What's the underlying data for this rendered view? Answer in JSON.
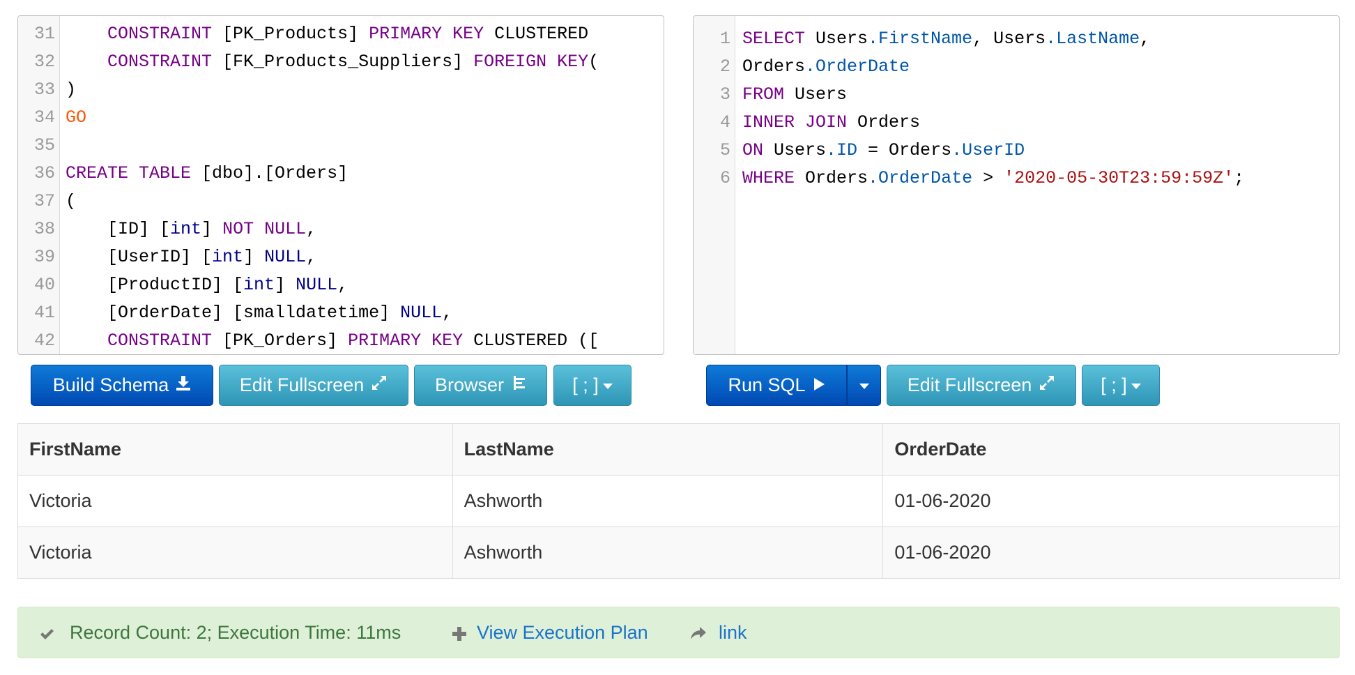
{
  "schema_editor": {
    "lines": [
      {
        "n": "31",
        "tokens": [
          {
            "t": "    "
          },
          {
            "t": "CONSTRAINT",
            "c": "kw"
          },
          {
            "t": " [PK_Products] "
          },
          {
            "t": "PRIMARY KEY",
            "c": "kw"
          },
          {
            "t": " CLUSTERED"
          }
        ]
      },
      {
        "n": "32",
        "tokens": [
          {
            "t": "    "
          },
          {
            "t": "CONSTRAINT",
            "c": "kw"
          },
          {
            "t": " [FK_Products_Suppliers] "
          },
          {
            "t": "FOREIGN KEY",
            "c": "kw"
          },
          {
            "t": "("
          }
        ]
      },
      {
        "n": "33",
        "tokens": [
          {
            "t": ")"
          }
        ]
      },
      {
        "n": "34",
        "tokens": [
          {
            "t": "GO",
            "c": "go"
          }
        ]
      },
      {
        "n": "35",
        "tokens": [
          {
            "t": ""
          }
        ]
      },
      {
        "n": "36",
        "tokens": [
          {
            "t": "CREATE TABLE",
            "c": "kw"
          },
          {
            "t": " [dbo].[Orders]"
          }
        ]
      },
      {
        "n": "37",
        "tokens": [
          {
            "t": "("
          }
        ]
      },
      {
        "n": "38",
        "tokens": [
          {
            "t": "    [ID] ["
          },
          {
            "t": "int",
            "c": "ty"
          },
          {
            "t": "] "
          },
          {
            "t": "NOT NULL",
            "c": "kw"
          },
          {
            "t": ","
          }
        ]
      },
      {
        "n": "39",
        "tokens": [
          {
            "t": "    [UserID] ["
          },
          {
            "t": "int",
            "c": "ty"
          },
          {
            "t": "] "
          },
          {
            "t": "NULL",
            "c": "ty"
          },
          {
            "t": ","
          }
        ]
      },
      {
        "n": "40",
        "tokens": [
          {
            "t": "    [ProductID] ["
          },
          {
            "t": "int",
            "c": "ty"
          },
          {
            "t": "] "
          },
          {
            "t": "NULL",
            "c": "ty"
          },
          {
            "t": ","
          }
        ]
      },
      {
        "n": "41",
        "tokens": [
          {
            "t": "    [OrderDate] [smalldatetime] "
          },
          {
            "t": "NULL",
            "c": "ty"
          },
          {
            "t": ","
          }
        ]
      },
      {
        "n": "42",
        "tokens": [
          {
            "t": "    "
          },
          {
            "t": "CONSTRAINT",
            "c": "kw"
          },
          {
            "t": " [PK_Orders] "
          },
          {
            "t": "PRIMARY KEY",
            "c": "kw"
          },
          {
            "t": " CLUSTERED (["
          }
        ]
      }
    ]
  },
  "query_editor": {
    "lines": [
      {
        "n": "1",
        "tokens": [
          {
            "t": "SELECT",
            "c": "kw"
          },
          {
            "t": " Users"
          },
          {
            "t": ".FirstName",
            "c": "pr"
          },
          {
            "t": ", Users"
          },
          {
            "t": ".LastName",
            "c": "pr"
          },
          {
            "t": ","
          }
        ]
      },
      {
        "n": "2",
        "tokens": [
          {
            "t": "Orders"
          },
          {
            "t": ".OrderDate",
            "c": "pr"
          }
        ]
      },
      {
        "n": "3",
        "tokens": [
          {
            "t": "FROM",
            "c": "kw"
          },
          {
            "t": " Users"
          }
        ]
      },
      {
        "n": "4",
        "tokens": [
          {
            "t": "INNER JOIN",
            "c": "kw"
          },
          {
            "t": " Orders"
          }
        ]
      },
      {
        "n": "5",
        "tokens": [
          {
            "t": "ON",
            "c": "kw"
          },
          {
            "t": " Users"
          },
          {
            "t": ".ID",
            "c": "pr"
          },
          {
            "t": " = Orders"
          },
          {
            "t": ".UserID",
            "c": "pr"
          }
        ]
      },
      {
        "n": "6",
        "tokens": [
          {
            "t": "WHERE",
            "c": "kw"
          },
          {
            "t": " Orders"
          },
          {
            "t": ".OrderDate",
            "c": "pr"
          },
          {
            "t": " > "
          },
          {
            "t": "'2020-05-30T23:59:59Z'",
            "c": "st"
          },
          {
            "t": ";"
          }
        ]
      }
    ]
  },
  "schema_toolbar": {
    "build_schema": "Build Schema",
    "edit_fullscreen": "Edit Fullscreen",
    "browser": "Browser",
    "delimiter": "[ ; ]"
  },
  "query_toolbar": {
    "run_sql": "Run SQL",
    "edit_fullscreen": "Edit Fullscreen",
    "delimiter": "[ ; ]"
  },
  "results": {
    "columns": [
      "FirstName",
      "LastName",
      "OrderDate"
    ],
    "rows": [
      [
        "Victoria",
        "Ashworth",
        "01-06-2020"
      ],
      [
        "Victoria",
        "Ashworth",
        "01-06-2020"
      ]
    ]
  },
  "status": {
    "summary": "Record Count: 2; Execution Time: 11ms",
    "execution_plan": "View Execution Plan",
    "link": "link"
  },
  "colors": {
    "keyword": "#770088",
    "type": "#000088",
    "go": "#ff5500",
    "property": "#0055aa",
    "string": "#aa1111",
    "primary_button": "#0a5fc4",
    "info_button": "#46aac9",
    "success_bg": "#dff0d8",
    "success_text": "#3c763d",
    "link": "#1a73c8"
  },
  "icons": {
    "build_schema": "download-icon",
    "edit_fullscreen": "expand-icon",
    "browser": "tree-icon",
    "run_sql": "play-icon",
    "status_ok": "checkmark-icon",
    "execution_plan": "plus-icon",
    "link": "share-arrow-icon"
  }
}
